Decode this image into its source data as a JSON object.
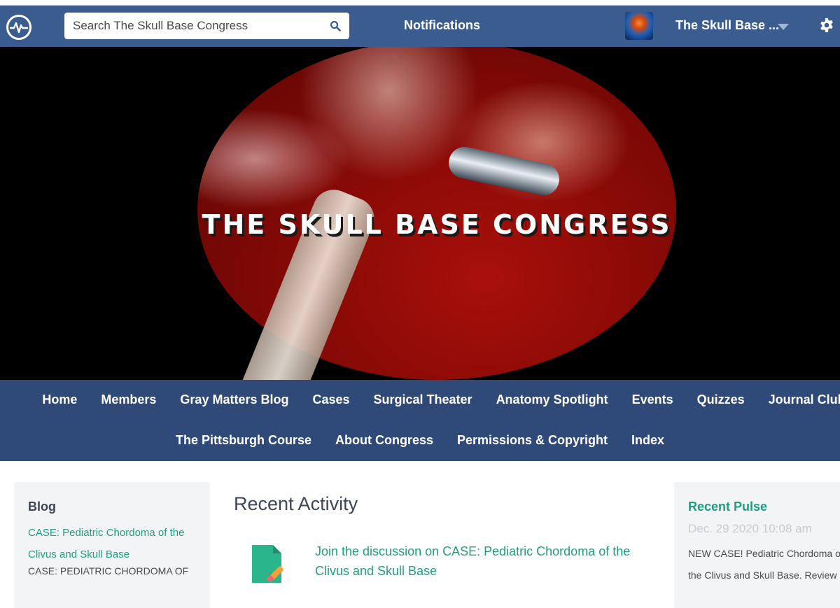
{
  "topbar": {
    "logo_icon": "pulse-heartbeat-icon",
    "search_placeholder": "Search The Skull Base Congress",
    "search_icon": "search-icon",
    "notifications_label": "Notifications",
    "site_name": "The Skull Base ...",
    "settings_icon": "gear-icon"
  },
  "hero": {
    "title": "THE SKULL BASE CONGRESS"
  },
  "nav": {
    "row1": [
      "Home",
      "Members",
      "Gray Matters Blog",
      "Cases",
      "Surgical Theater",
      "Anatomy Spotlight",
      "Events",
      "Quizzes",
      "Journal Club"
    ],
    "row2": [
      "The Pittsburgh Course",
      "About Congress",
      "Permissions & Copyright",
      "Index"
    ]
  },
  "blog": {
    "heading": "Blog",
    "link": "CASE: Pediatric Chordoma of the Clivus and Skull Base",
    "excerpt": "CASE: PEDIATRIC CHORDOMA OF"
  },
  "recent_activity": {
    "heading": "Recent Activity",
    "item_link": "Join the discussion on CASE: Pediatric Chordoma of the Clivus and Skull Base"
  },
  "recent_pulse": {
    "heading": "Recent Pulse",
    "date": "Dec. 29 2020 10:08 am",
    "line1": "NEW CASE! Pediatric Chordoma of",
    "line2": "the Clivus and Skull Base. Review"
  },
  "colors": {
    "topbar": "#3b5c8f",
    "nav": "#2f4a78",
    "accent_green": "#1f9f7f"
  }
}
